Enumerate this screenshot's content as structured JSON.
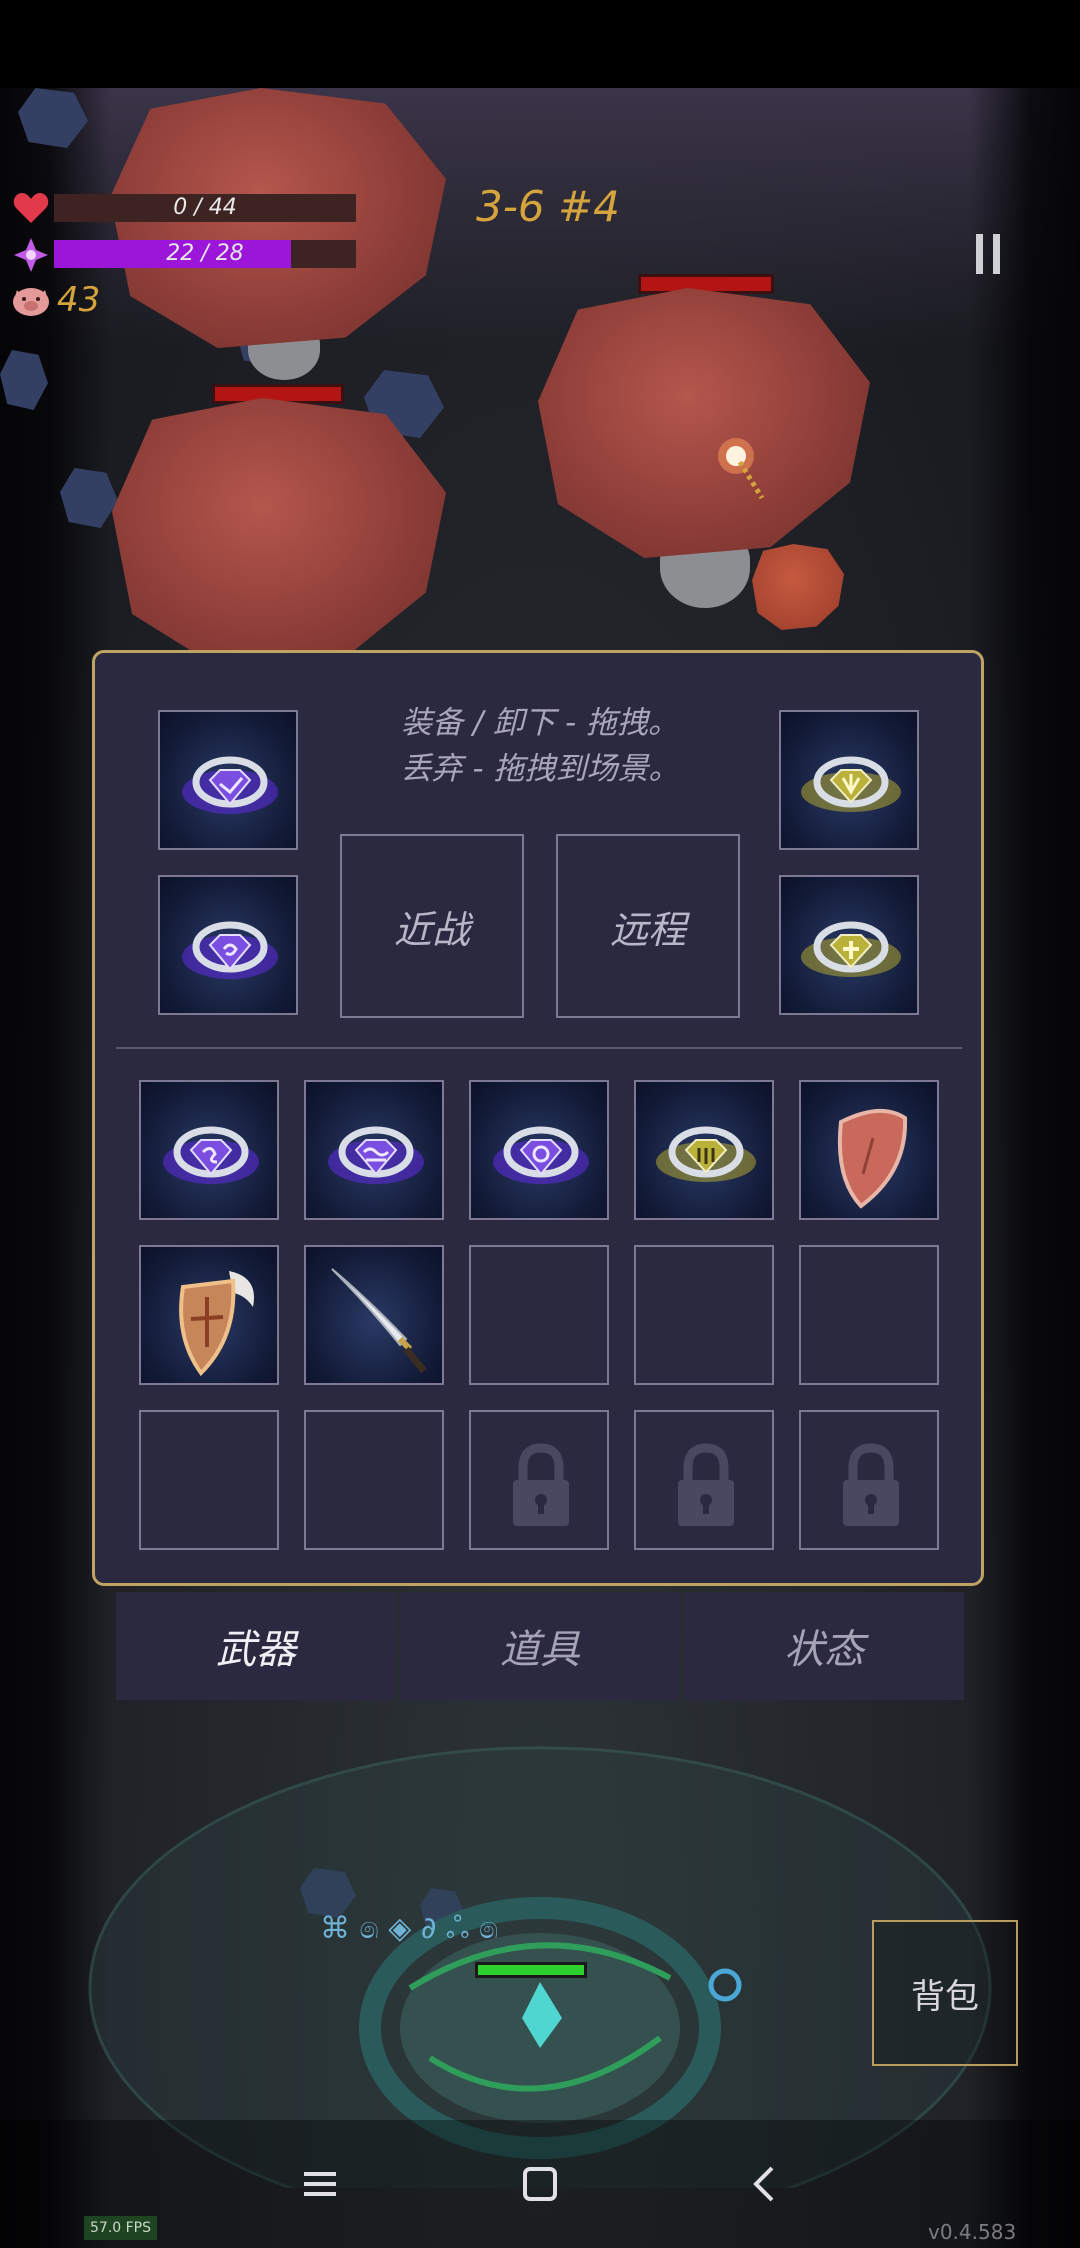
{
  "hud": {
    "hp_text": "0 / 44",
    "hp_fraction": 0.0,
    "mana_text": "22 / 28",
    "mana_fraction": 0.786,
    "coins": "43",
    "wave": "3-6 #4"
  },
  "panel": {
    "instructions_line1": "装备 / 卸下 - 拖拽。",
    "instructions_line2": "丢弃 - 拖拽到场景。",
    "melee_label": "近战",
    "ranged_label": "远程",
    "equipped_left": [
      "purple-ring-icon",
      "purple-swirl-ring-icon"
    ],
    "equipped_right": [
      "gold-leaf-ring-icon",
      "gold-cross-ring-icon"
    ],
    "inventory": [
      "purple-rune-ring-icon",
      "purple-wave-ring-icon",
      "purple-spiral-ring-icon",
      "gold-bars-ring-icon",
      "shield-icon",
      "winged-shield-icon",
      "sword-icon",
      "empty",
      "empty",
      "empty",
      "empty",
      "empty",
      "locked",
      "locked",
      "locked"
    ]
  },
  "tabs": [
    "武器",
    "道具",
    "状态"
  ],
  "active_tab": "武器",
  "bag_button": "背包",
  "fps": "57.0 FPS",
  "version": "v0.4.583",
  "colors": {
    "hp": "#e23a4a",
    "mana": "#9b16d8",
    "gold_text": "#d6a43c",
    "panel_border": "#bfa365",
    "panel_bg": "#2b2940",
    "enemy_hp": "#b31414"
  }
}
